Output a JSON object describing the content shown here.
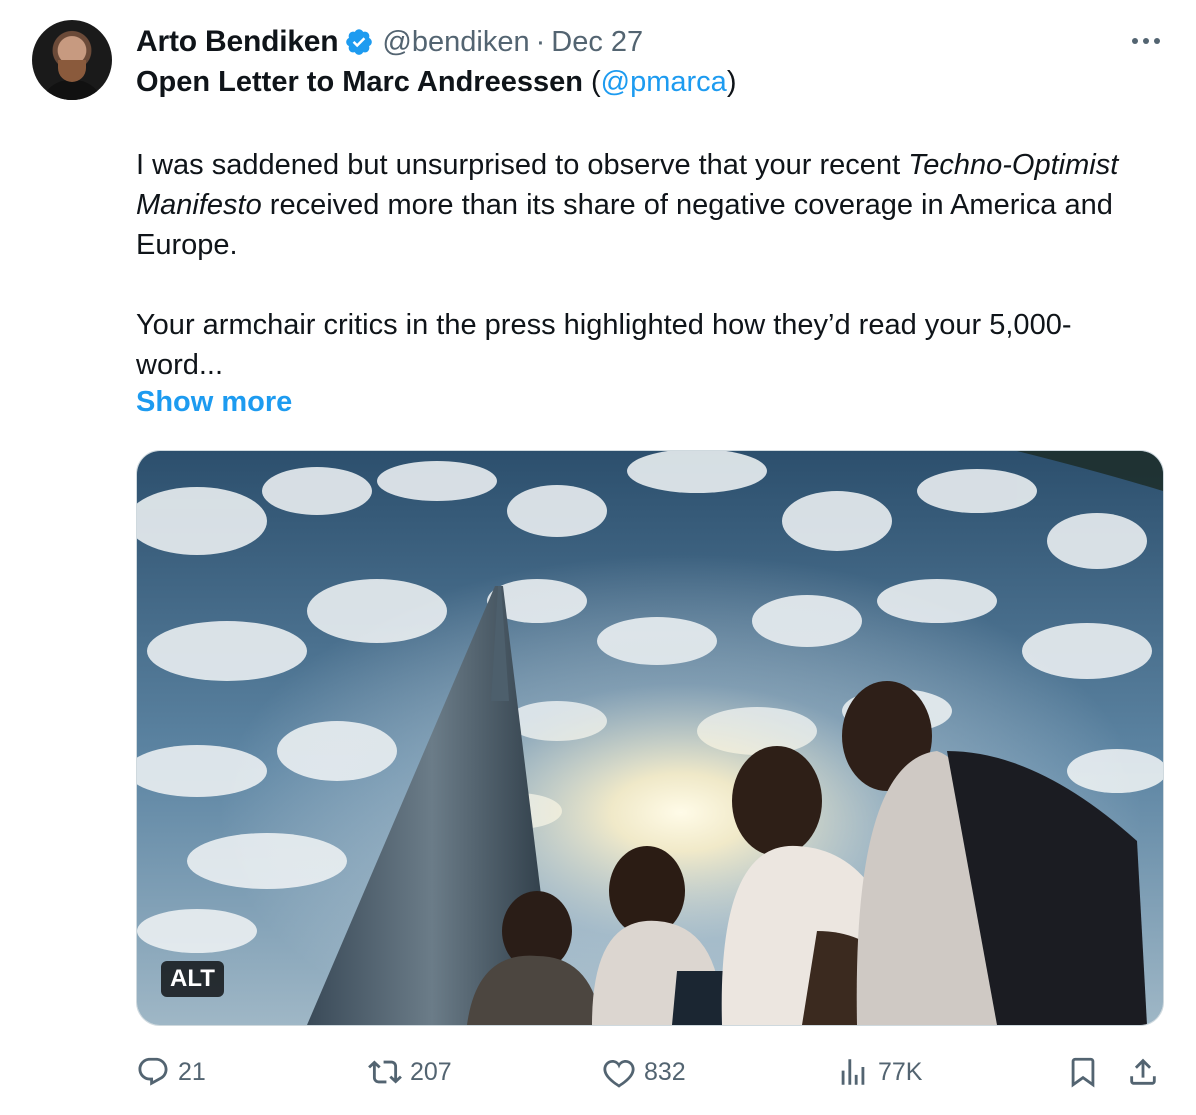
{
  "tweet": {
    "author_name": "Arto Bendiken",
    "handle": "@bendiken",
    "separator": "·",
    "date": "Dec 27",
    "title_text": "Open Letter to Marc Andreessen",
    "title_open": "(",
    "title_mention": "@pmarca",
    "title_close": ")",
    "p1_start": "I was saddened but unsurprised to observe that your recent ",
    "p1_italic": "Techno-Optimist Manifesto",
    "p1_end": " received more than its share of negative coverage in America and Europe.",
    "p2": "Your armchair critics in the press highlighted how they’d read your 5,000-word...",
    "show_more": "Show more",
    "alt_badge": "ALT"
  },
  "actions": {
    "reply_count": "21",
    "retweet_count": "207",
    "like_count": "832",
    "views_count": "77K"
  },
  "icons": {
    "verified": "verified-badge-icon",
    "more": "more-options-icon",
    "reply": "reply-icon",
    "retweet": "retweet-icon",
    "like": "heart-icon",
    "views": "views-chart-icon",
    "bookmark": "bookmark-icon",
    "share": "share-icon"
  },
  "colors": {
    "accent": "#1d9bf0",
    "text": "#0f1419",
    "muted": "#536471"
  }
}
